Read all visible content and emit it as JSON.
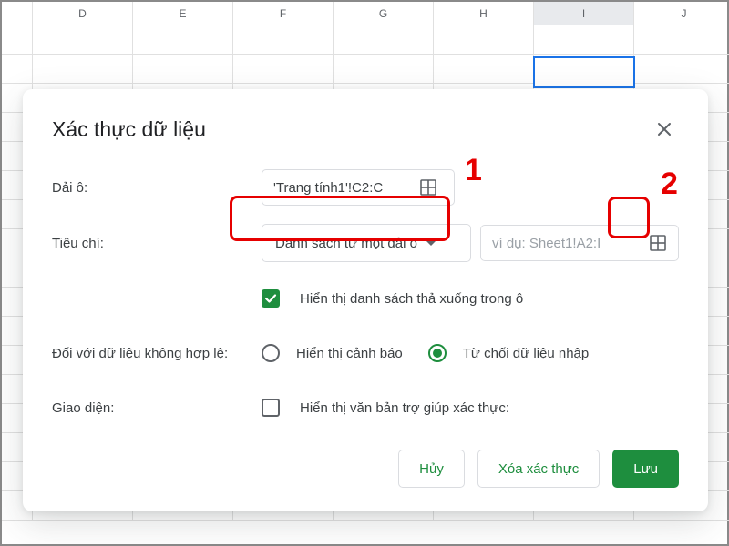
{
  "sheet": {
    "columns": [
      "D",
      "E",
      "F",
      "G",
      "H",
      "I",
      "J"
    ]
  },
  "dialog": {
    "title": "Xác thực dữ liệu",
    "range_label": "Dải ô:",
    "range_value": "'Trang tính1'!C2:C",
    "criteria_label": "Tiêu chí:",
    "criteria_dropdown": "Danh sách từ một dải ô",
    "criteria_range_placeholder": "ví dụ: Sheet1!A2:I",
    "show_dropdown_label": "Hiển thị danh sách thả xuống trong ô",
    "invalid_label": "Đối với dữ liệu không hợp lệ:",
    "invalid_warn": "Hiển thị cảnh báo",
    "invalid_reject": "Từ chối dữ liệu nhập",
    "appearance_label": "Giao diện:",
    "help_text_label": "Hiển thị văn bản trợ giúp xác thực:",
    "cancel": "Hủy",
    "remove": "Xóa xác thực",
    "save": "Lưu"
  },
  "annotations": {
    "one": "1",
    "two": "2"
  }
}
